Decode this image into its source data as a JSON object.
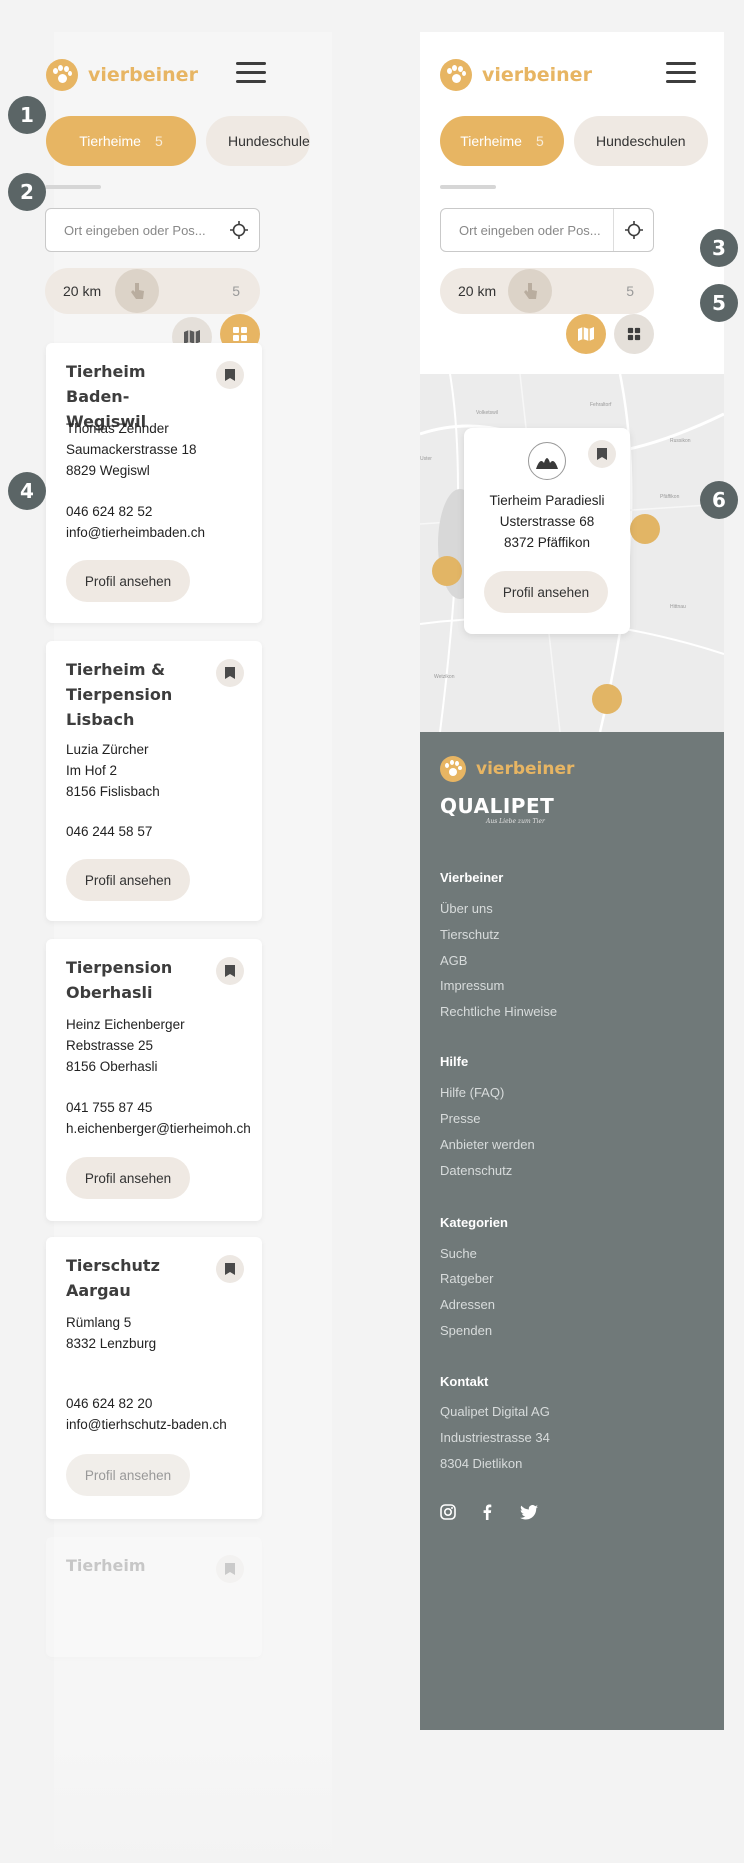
{
  "brand": {
    "name": "vierbeiner",
    "accent": "#e7b563",
    "footer_bg": "#707979",
    "partner": "QUALIPET",
    "partner_tagline": "Aus Liebe zum Tier"
  },
  "tabs": [
    {
      "label": "Tierheime",
      "count": "5",
      "active": true
    },
    {
      "label": "Hundeschulen",
      "active": false
    }
  ],
  "search": {
    "placeholder": "Ort eingeben oder Pos..."
  },
  "range": {
    "value_label": "20 km",
    "max_label": "5",
    "level": 0.4
  },
  "listings": [
    {
      "title": "Tierheim Baden-Wegiswil",
      "lines": [
        "Thomas Zehnder",
        "Saumackerstrasse 18",
        "8829 Wegiswl"
      ],
      "contact": [
        "046 624 82 52",
        "info@tierheimbaden.ch"
      ],
      "button": "Profil ansehen"
    },
    {
      "title": "Tierheim & Tierpension Lisbach",
      "lines": [
        "Luzia Zürcher",
        "Im Hof 2",
        "8156 Fislisbach"
      ],
      "contact": [
        "046 244 58 57"
      ],
      "button": "Profil ansehen"
    },
    {
      "title": "Tierpension Oberhasli",
      "lines": [
        "Heinz Eichenberger",
        "Rebstrasse 25",
        "8156 Oberhasli"
      ],
      "contact": [
        "041 755 87 45",
        "h.eichenberger@tierheimoh.ch"
      ],
      "button": "Profil ansehen"
    },
    {
      "title": "Tierschutz Aargau",
      "lines": [
        "Rümlang 5",
        "8332 Lenzburg"
      ],
      "contact": [
        "046 624 82 20",
        "info@tierhschutz-baden.ch"
      ],
      "button": "Profil ansehen"
    },
    {
      "title": "Tierheim"
    }
  ],
  "map_popup": {
    "lines": [
      "Tierheim Paradiesli",
      "Usterstrasse 68",
      "8372 Pfäffikon"
    ],
    "button": "Profil ansehen"
  },
  "map_labels": [
    "Volketswil",
    "Fehraltorf",
    "Russikon",
    "Pfäffikon",
    "Uster",
    "Hittnau",
    "Wetzikon"
  ],
  "footer": {
    "sections": [
      {
        "title": "Vierbeiner",
        "items": [
          "Über uns",
          "Tierschutz",
          "AGB",
          "Impressum",
          "Rechtliche Hinweise"
        ]
      },
      {
        "title": "Hilfe",
        "items": [
          "Hilfe (FAQ)",
          "Presse",
          "Anbieter werden",
          "Datenschutz"
        ]
      },
      {
        "title": "Kategorien",
        "items": [
          "Suche",
          "Ratgeber",
          "Adressen",
          "Spenden"
        ]
      },
      {
        "title": "Kontakt",
        "items": [
          "Qualipet Digital AG",
          "Industriestrasse 34",
          "8304 Dietlikon"
        ]
      }
    ],
    "social": [
      "instagram-icon",
      "facebook-icon",
      "twitter-icon"
    ]
  },
  "markers": [
    "1",
    "2",
    "3",
    "4",
    "5",
    "6"
  ]
}
